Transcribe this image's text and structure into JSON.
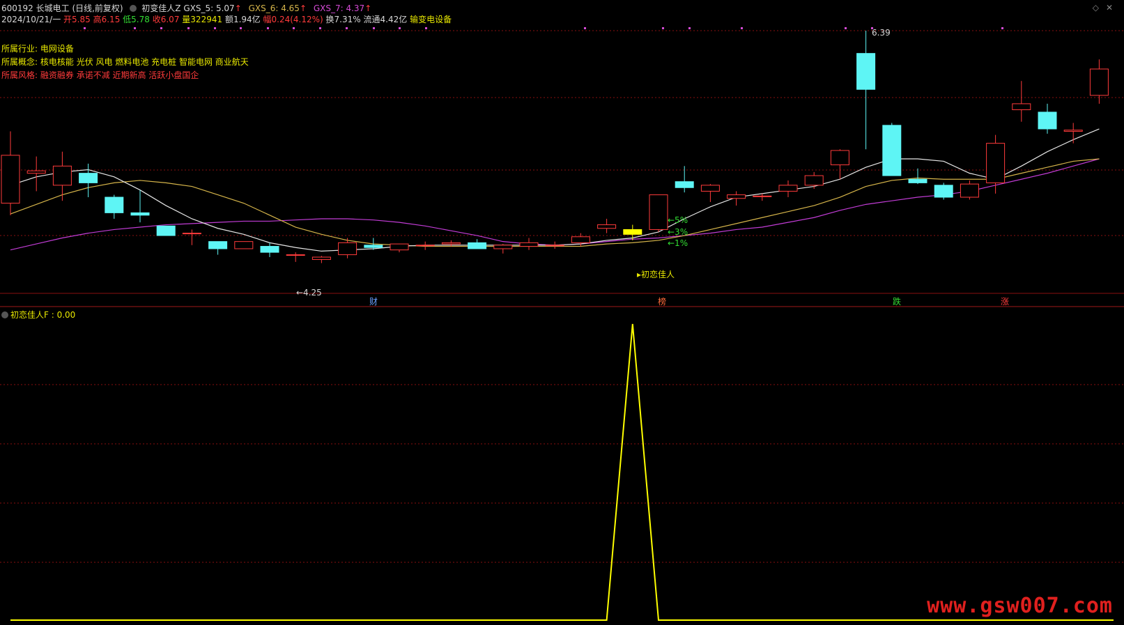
{
  "header": {
    "code_name": "600192 长城电工 (日线,前复权)",
    "formula": "初变佳人Z",
    "gxs5_label": "GXS_5: 5.07",
    "gxs6_label": "GXS_6: 4.65",
    "gxs7_label": "GXS_7: 4.37",
    "up_arrow": "↑",
    "date": "2024/10/21/一",
    "open": "开5.85",
    "high": "高6.15",
    "low": "低5.78",
    "close": "收6.07",
    "volume": "量322941",
    "amount": "额1.94亿",
    "change": "幅0.24(4.12%)",
    "turnover": "换7.31%",
    "float": "流通4.42亿",
    "sector_tag": "输变电设备"
  },
  "info": {
    "industry_label": "所属行业:",
    "industry_value": "电网设备",
    "concept_label": "所属概念:",
    "concept_value": "核电核能 光伏 风电 燃料电池 充电桩 智能电网 商业航天",
    "style_label": "所属风格:",
    "style_value": "融资融券 承诺不减 近期新高 活跃小盘国企"
  },
  "annotations": {
    "high_marker": "6.39",
    "low_marker": "←4.25",
    "pct5": "←5%",
    "pct3": "←3%",
    "pct1": "←1%",
    "signal": "▸初恋佳人"
  },
  "markers": {
    "cai": "财",
    "bang": "榜",
    "die": "跌",
    "zhang": "涨"
  },
  "sub": {
    "label": "初恋佳人F : 0.00"
  },
  "watermark": "www.gsw007.com",
  "colors": {
    "up": "#ff3b3b",
    "down": "#5ef5f5",
    "ma5": "#e6e6e6",
    "ma6": "#d6b54a",
    "ma7": "#c23cd6",
    "signal": "#ffff00",
    "grid": "#8a1010"
  },
  "chart_data": {
    "type": "candlestick",
    "candles": [
      {
        "o": 4.95,
        "h": 5.55,
        "l": 4.85,
        "c": 5.35,
        "up": true
      },
      {
        "o": 5.22,
        "h": 5.34,
        "l": 5.05,
        "c": 5.2,
        "up": true
      },
      {
        "o": 5.1,
        "h": 5.38,
        "l": 4.97,
        "c": 5.26,
        "up": true
      },
      {
        "o": 5.2,
        "h": 5.28,
        "l": 5.0,
        "c": 5.12,
        "up": false
      },
      {
        "o": 5.0,
        "h": 5.02,
        "l": 4.82,
        "c": 4.87,
        "up": false
      },
      {
        "o": 4.87,
        "h": 5.06,
        "l": 4.79,
        "c": 4.85,
        "up": false
      },
      {
        "o": 4.76,
        "h": 4.76,
        "l": 4.68,
        "c": 4.68,
        "up": false
      },
      {
        "o": 4.7,
        "h": 4.73,
        "l": 4.6,
        "c": 4.7,
        "up": true
      },
      {
        "o": 4.63,
        "h": 4.63,
        "l": 4.52,
        "c": 4.57,
        "up": false
      },
      {
        "o": 4.57,
        "h": 4.63,
        "l": 4.57,
        "c": 4.63,
        "up": true
      },
      {
        "o": 4.59,
        "h": 4.62,
        "l": 4.5,
        "c": 4.54,
        "up": false
      },
      {
        "o": 4.52,
        "h": 4.54,
        "l": 4.46,
        "c": 4.52,
        "up": true
      },
      {
        "o": 4.48,
        "h": 4.51,
        "l": 4.45,
        "c": 4.5,
        "up": true
      },
      {
        "o": 4.52,
        "h": 4.66,
        "l": 4.49,
        "c": 4.62,
        "up": true
      },
      {
        "o": 4.6,
        "h": 4.66,
        "l": 4.56,
        "c": 4.58,
        "up": false
      },
      {
        "o": 4.56,
        "h": 4.61,
        "l": 4.54,
        "c": 4.61,
        "up": true
      },
      {
        "o": 4.6,
        "h": 4.63,
        "l": 4.56,
        "c": 4.6,
        "up": true
      },
      {
        "o": 4.61,
        "h": 4.64,
        "l": 4.59,
        "c": 4.62,
        "up": true
      },
      {
        "o": 4.62,
        "h": 4.65,
        "l": 4.58,
        "c": 4.57,
        "up": false
      },
      {
        "o": 4.57,
        "h": 4.61,
        "l": 4.53,
        "c": 4.6,
        "up": true
      },
      {
        "o": 4.59,
        "h": 4.66,
        "l": 4.56,
        "c": 4.62,
        "up": true
      },
      {
        "o": 4.6,
        "h": 4.63,
        "l": 4.57,
        "c": 4.6,
        "up": true
      },
      {
        "o": 4.62,
        "h": 4.7,
        "l": 4.59,
        "c": 4.67,
        "up": true
      },
      {
        "o": 4.74,
        "h": 4.82,
        "l": 4.7,
        "c": 4.77,
        "up": true
      },
      {
        "o": 4.69,
        "h": 4.77,
        "l": 4.64,
        "c": 4.73,
        "up": true
      },
      {
        "o": 4.73,
        "h": 5.02,
        "l": 4.71,
        "c": 5.02,
        "up": true
      },
      {
        "o": 5.13,
        "h": 5.26,
        "l": 5.04,
        "c": 5.08,
        "up": false
      },
      {
        "o": 5.05,
        "h": 5.11,
        "l": 4.96,
        "c": 5.1,
        "up": true
      },
      {
        "o": 4.99,
        "h": 5.05,
        "l": 4.93,
        "c": 5.02,
        "up": true
      },
      {
        "o": 5.01,
        "h": 5.03,
        "l": 4.97,
        "c": 5.01,
        "up": true
      },
      {
        "o": 5.05,
        "h": 5.14,
        "l": 5.0,
        "c": 5.1,
        "up": true
      },
      {
        "o": 5.1,
        "h": 5.21,
        "l": 5.07,
        "c": 5.18,
        "up": true
      },
      {
        "o": 5.27,
        "h": 5.4,
        "l": 5.15,
        "c": 5.39,
        "up": true
      },
      {
        "o": 6.2,
        "h": 6.39,
        "l": 5.4,
        "c": 5.9,
        "up": false
      },
      {
        "o": 5.6,
        "h": 5.62,
        "l": 5.18,
        "c": 5.18,
        "up": false
      },
      {
        "o": 5.15,
        "h": 5.24,
        "l": 5.11,
        "c": 5.12,
        "up": false
      },
      {
        "o": 5.1,
        "h": 5.12,
        "l": 4.98,
        "c": 5.0,
        "up": false
      },
      {
        "o": 5.0,
        "h": 5.14,
        "l": 4.98,
        "c": 5.11,
        "up": true
      },
      {
        "o": 5.12,
        "h": 5.52,
        "l": 5.03,
        "c": 5.45,
        "up": true
      },
      {
        "o": 5.78,
        "h": 5.97,
        "l": 5.63,
        "c": 5.73,
        "up": true
      },
      {
        "o": 5.71,
        "h": 5.78,
        "l": 5.53,
        "c": 5.57,
        "up": false
      },
      {
        "o": 5.55,
        "h": 5.62,
        "l": 5.45,
        "c": 5.56,
        "up": true
      },
      {
        "o": 5.85,
        "h": 6.15,
        "l": 5.78,
        "c": 6.07,
        "up": true
      }
    ],
    "ma5": [
      5.1,
      5.17,
      5.21,
      5.23,
      5.17,
      5.06,
      4.93,
      4.82,
      4.74,
      4.69,
      4.62,
      4.58,
      4.55,
      4.56,
      4.57,
      4.59,
      4.6,
      4.6,
      4.6,
      4.6,
      4.6,
      4.6,
      4.61,
      4.64,
      4.66,
      4.71,
      4.82,
      4.92,
      5.0,
      5.03,
      5.06,
      5.09,
      5.15,
      5.25,
      5.32,
      5.32,
      5.3,
      5.2,
      5.15,
      5.26,
      5.38,
      5.48,
      5.57
    ],
    "ma6": [
      4.86,
      4.94,
      5.02,
      5.08,
      5.12,
      5.14,
      5.12,
      5.09,
      5.02,
      4.95,
      4.85,
      4.75,
      4.69,
      4.64,
      4.61,
      4.6,
      4.59,
      4.59,
      4.59,
      4.59,
      4.59,
      4.59,
      4.59,
      4.61,
      4.62,
      4.64,
      4.68,
      4.73,
      4.78,
      4.83,
      4.88,
      4.93,
      5.0,
      5.09,
      5.14,
      5.16,
      5.15,
      5.15,
      5.15,
      5.2,
      5.25,
      5.3,
      5.32
    ],
    "ma7": [
      4.56,
      4.61,
      4.66,
      4.7,
      4.73,
      4.75,
      4.77,
      4.78,
      4.79,
      4.8,
      4.8,
      4.81,
      4.82,
      4.82,
      4.81,
      4.79,
      4.76,
      4.72,
      4.68,
      4.63,
      4.61,
      4.6,
      4.61,
      4.63,
      4.65,
      4.66,
      4.68,
      4.7,
      4.73,
      4.75,
      4.79,
      4.83,
      4.89,
      4.94,
      4.97,
      5.0,
      5.02,
      5.05,
      5.1,
      5.15,
      5.2,
      5.26,
      5.32
    ],
    "signal_index": 24,
    "sub_values": [
      0,
      0,
      0,
      0,
      0,
      0,
      0,
      0,
      0,
      0,
      0,
      0,
      0,
      0,
      0,
      0,
      0,
      0,
      0,
      0,
      0,
      0,
      0,
      0,
      1,
      0,
      0,
      0,
      0,
      0,
      0,
      0,
      0,
      0,
      0,
      0,
      0,
      0,
      0,
      0,
      0,
      0,
      0
    ],
    "ylim": [
      4.25,
      6.39
    ]
  }
}
